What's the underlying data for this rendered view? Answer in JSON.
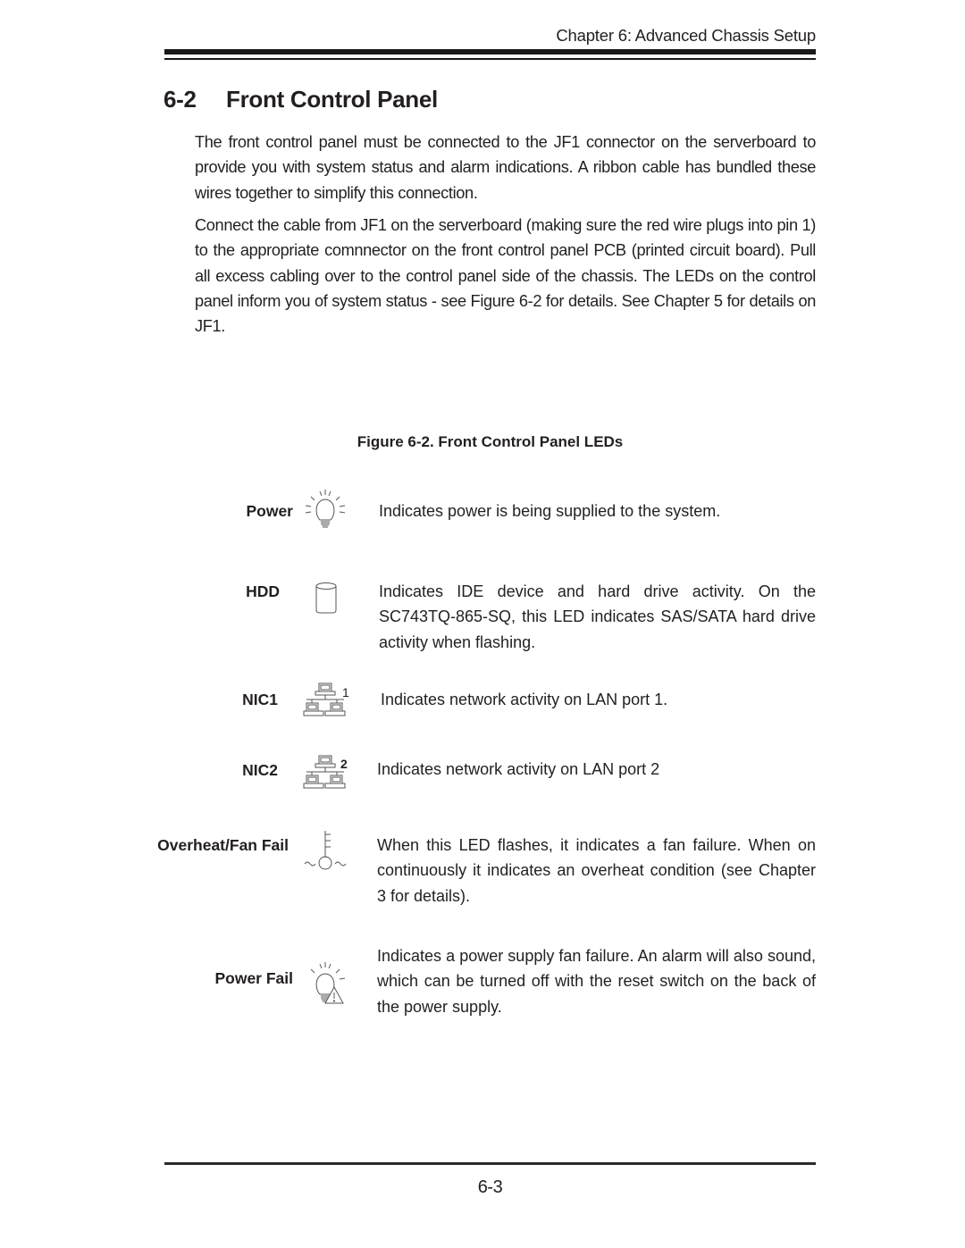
{
  "header": {
    "running_head": "Chapter 6: Advanced Chassis Setup"
  },
  "section": {
    "number": "6-2",
    "title": "Front Control Panel"
  },
  "paragraphs": [
    "The front control panel must be connected to the JF1 connector on the serverboard to provide you with system status and alarm indications. A ribbon cable has bundled these wires together to simplify this connection.",
    "Connect the cable from JF1 on the serverboard (making sure the red wire plugs into pin 1) to the appropriate comnnector on the front control panel PCB (printed circuit board). Pull all excess cabling over to the control panel side of the chassis. The LEDs on the control panel inform you of system status - see Figure 6-2 for details. See Chapter 5 for details on JF1."
  ],
  "figure": {
    "caption": "Figure 6-2.  Front Control Panel LEDs"
  },
  "leds": [
    {
      "label": "Power",
      "icon": "lightbulb-icon",
      "description": "Indicates power is being supplied to the system."
    },
    {
      "label": "HDD",
      "icon": "hard-drive-cylinder-icon",
      "description": "Indicates IDE device and hard drive activity. On the SC743TQ-865-SQ, this LED indicates SAS/SATA hard drive activity when flashing."
    },
    {
      "label": "NIC1",
      "icon": "network-icon",
      "icon_number": "1",
      "description": "Indicates network activity on LAN port 1."
    },
    {
      "label": "NIC2",
      "icon": "network-icon",
      "icon_number": "2",
      "description": "Indicates network activity on LAN port 2"
    },
    {
      "label": "Overheat/Fan Fail",
      "icon": "thermometer-fan-icon",
      "description": "When this LED flashes, it indicates a fan failure. When on continuously it indicates an overheat condition (see Chapter 3 for details)."
    },
    {
      "label": "Power Fail",
      "icon": "lightbulb-warning-icon",
      "description": "Indicates a power supply fan failure. An alarm will also sound, which can be turned off with the reset switch on the back of the power supply."
    }
  ],
  "footer": {
    "page_number": "6-3"
  }
}
